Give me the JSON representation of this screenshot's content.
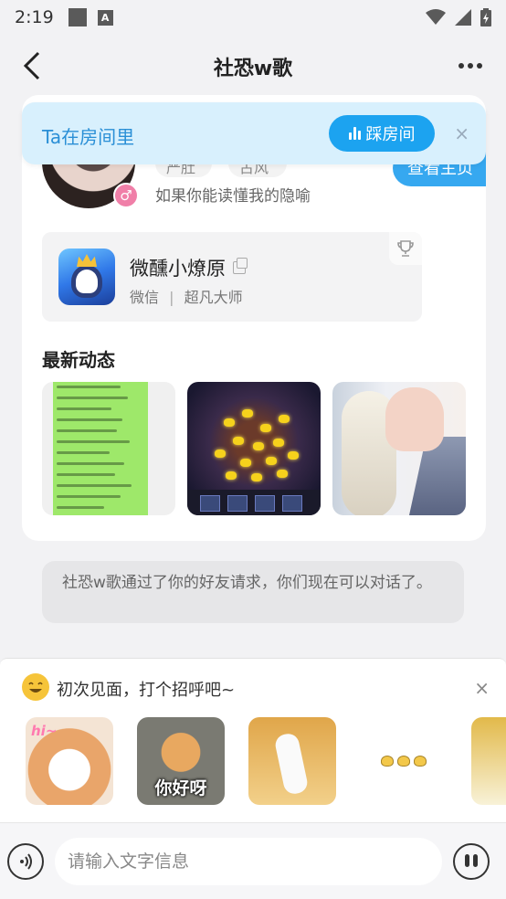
{
  "status_bar": {
    "time": "2:19",
    "sim_icon_label": "A"
  },
  "nav": {
    "title": "社恐w歌",
    "back_icon": "chevron-left-icon",
    "more_icon": "more-dots-icon"
  },
  "room_banner": {
    "text": "Ta在房间里",
    "button_label": "踩房间",
    "close_label": "×"
  },
  "profile": {
    "tags": [
      "严肚",
      "古风"
    ],
    "motto": "如果你能读懂我的隐喻",
    "gender_symbol": "♂",
    "view_home_label": "查看主页",
    "game": {
      "name": "微醺小燎原",
      "platform": "微信",
      "separator": "|",
      "rank": "超凡大师"
    }
  },
  "moments": {
    "title": "最新动态"
  },
  "system_message": "社恐w歌通过了你的好友请求，你们现在可以对话了。",
  "greeting": {
    "text": "初次见面，打个招呼吧~",
    "close_label": "×",
    "stickers": [
      {
        "label": "hi~"
      },
      {
        "label": "你好呀"
      }
    ]
  },
  "input_bar": {
    "placeholder": "请输入文字信息"
  },
  "colors": {
    "accent": "#1ca3f0",
    "banner_bg": "#d8f0fd",
    "banner_text": "#2a8fd6",
    "page_bg": "#f2f2f4"
  }
}
